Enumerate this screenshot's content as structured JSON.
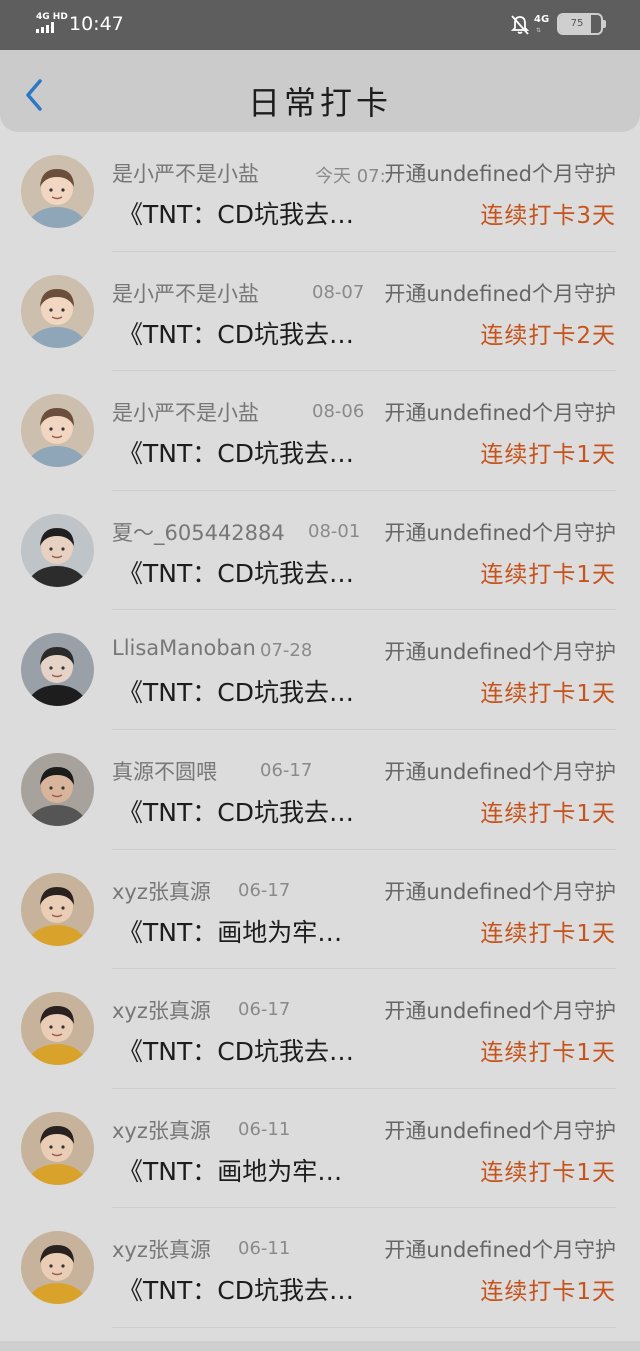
{
  "status_bar": {
    "network": "4G HD",
    "time": "10:47",
    "mobile_data": "4G",
    "battery_percent": 75,
    "battery_text": "75"
  },
  "header": {
    "title": "日常打卡",
    "back_icon": "chevron-left-icon"
  },
  "colors": {
    "accent_blue": "#2b78c4",
    "streak_orange": "#c6531c"
  },
  "items": [
    {
      "name": "是小严不是小盐",
      "date": "今天 07:",
      "action": "开通undefined个月守护",
      "song": "《TNT：CD坑我去…",
      "streak": "连续打卡3天"
    },
    {
      "name": "是小严不是小盐",
      "date": "08-07",
      "action": "开通undefined个月守护",
      "song": "《TNT：CD坑我去…",
      "streak": "连续打卡2天"
    },
    {
      "name": "是小严不是小盐",
      "date": "08-06",
      "action": "开通undefined个月守护",
      "song": "《TNT：CD坑我去…",
      "streak": "连续打卡1天"
    },
    {
      "name": "夏～_605442884",
      "date": "08-01",
      "action": "开通undefined个月守护",
      "song": "《TNT：CD坑我去…",
      "streak": "连续打卡1天"
    },
    {
      "name": "LlisaManoban",
      "date": "07-28",
      "action": "开通undefined个月守护",
      "song": "《TNT：CD坑我去…",
      "streak": "连续打卡1天"
    },
    {
      "name": "真源不圆喂",
      "date": "06-17",
      "action": "开通undefined个月守护",
      "song": "《TNT：CD坑我去…",
      "streak": "连续打卡1天"
    },
    {
      "name": "xyz张真源",
      "date": "06-17",
      "action": "开通undefined个月守护",
      "song": "《TNT：画地为牢…",
      "streak": "连续打卡1天"
    },
    {
      "name": "xyz张真源",
      "date": "06-17",
      "action": "开通undefined个月守护",
      "song": "《TNT：CD坑我去…",
      "streak": "连续打卡1天"
    },
    {
      "name": "xyz张真源",
      "date": "06-11",
      "action": "开通undefined个月守护",
      "song": "《TNT：画地为牢…",
      "streak": "连续打卡1天"
    },
    {
      "name": "xyz张真源",
      "date": "06-11",
      "action": "开通undefined个月守护",
      "song": "《TNT：CD坑我去…",
      "streak": "连续打卡1天"
    }
  ]
}
